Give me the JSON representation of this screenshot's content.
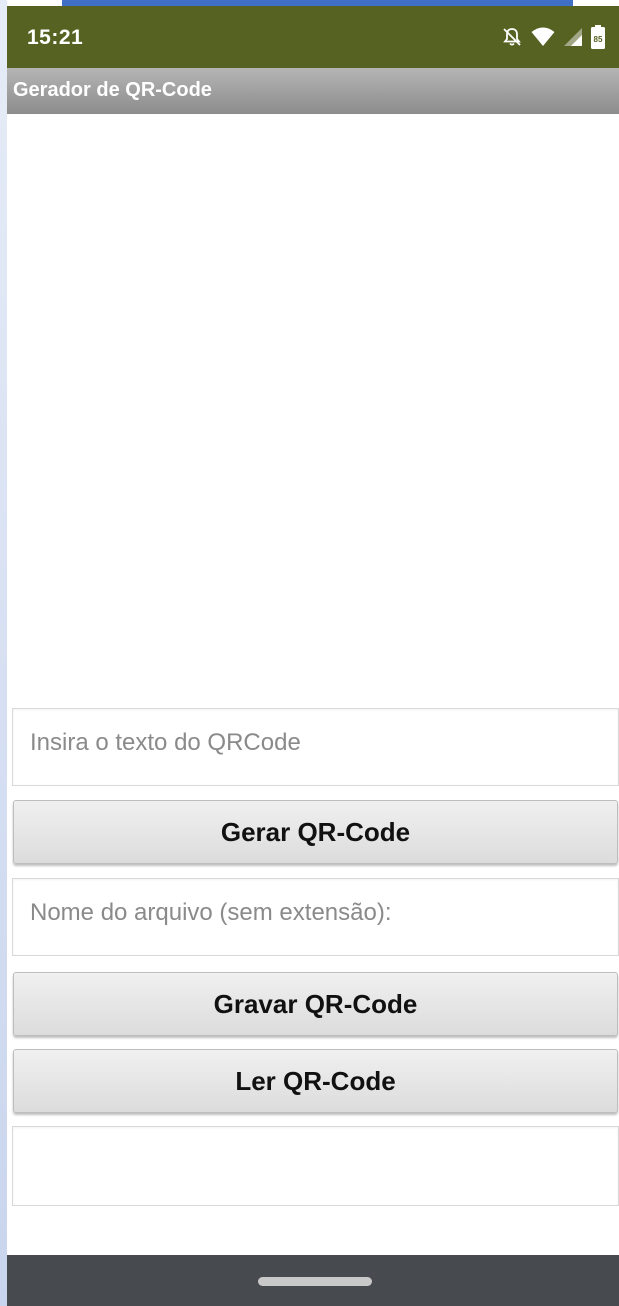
{
  "status_bar": {
    "time": "15:21",
    "battery_level": "85",
    "icons": [
      "notifications-off-icon",
      "wifi-icon",
      "signal-icon",
      "battery-icon"
    ],
    "background": "#566222"
  },
  "app": {
    "title": "Gerador de QR-Code",
    "title_bar_color": "#9e9e9e"
  },
  "form": {
    "qr_text_placeholder": "Insira o texto do QRCode",
    "generate_button": "Gerar QR-Code",
    "filename_placeholder": "Nome do arquivo (sem extensão):",
    "save_button": "Gravar QR-Code",
    "read_button": "Ler QR-Code",
    "result_text": ""
  },
  "navigation": {
    "home_indicator": "home-gesture-pill"
  }
}
